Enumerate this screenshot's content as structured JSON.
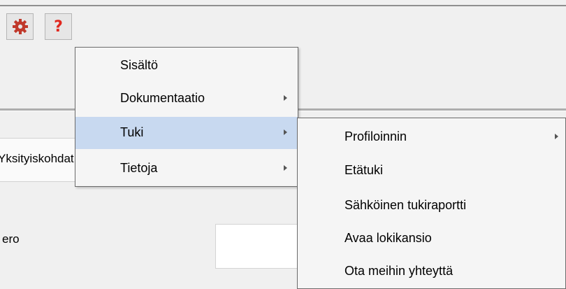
{
  "toolbar": {
    "settings_icon": "gear-icon",
    "help_icon": "question-mark-icon",
    "help_glyph": "?"
  },
  "lower_panel": {
    "tab_label": "Yksityiskohdat",
    "field_label": "ero"
  },
  "help_menu": {
    "items": [
      {
        "label": "Sisältö",
        "has_submenu": false
      },
      {
        "label": "Dokumentaatio",
        "has_submenu": true
      },
      {
        "label": "Tuki",
        "has_submenu": true,
        "highlighted": true
      },
      {
        "label": "Tietoja",
        "has_submenu": true
      }
    ]
  },
  "support_submenu": {
    "items": [
      {
        "label": "Profiloinnin",
        "has_submenu": true
      },
      {
        "label": "Etätuki",
        "has_submenu": false
      },
      {
        "label": "Sähköinen tukiraportti",
        "has_submenu": false
      },
      {
        "label": "Avaa lokikansio",
        "has_submenu": false
      },
      {
        "label": "Ota meihin yhteyttä",
        "has_submenu": false
      }
    ]
  },
  "colors": {
    "highlight": "#c8d9f0",
    "gear": "#c0392b",
    "help": "#e0271e"
  }
}
